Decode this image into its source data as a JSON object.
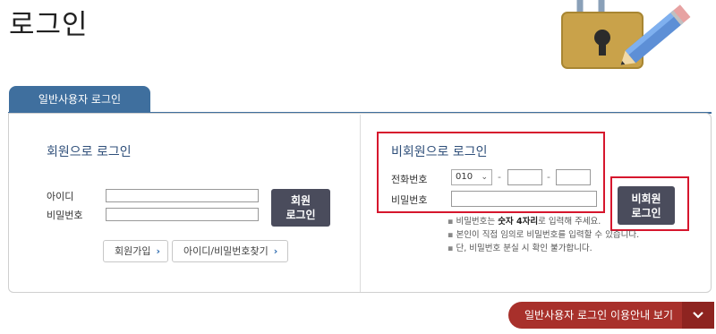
{
  "page": {
    "title": "로그인"
  },
  "tabs": [
    {
      "label": "일반사용자 로그인",
      "active": true
    }
  ],
  "member_login": {
    "title": "회원으로 로그인",
    "id_label": "아이디",
    "password_label": "비밀번호",
    "id_value": "",
    "password_value": "",
    "login_button": "회원\n로그인",
    "login_button_line1": "회원",
    "login_button_line2": "로그인",
    "signup_button": "회원가입",
    "find_button": "아이디/비밀번호찾기"
  },
  "guest_login": {
    "title": "비회원으로 로그인",
    "phone_label": "전화번호",
    "password_label": "비밀번호",
    "phone_prefix": "010",
    "phone_separator": "-",
    "phone_middle": "",
    "phone_last": "",
    "password_value": "",
    "login_button_line1": "비회원",
    "login_button_line2": "로그인",
    "notes": {
      "note1_pre": "비밀번호는 ",
      "note1_bold": "숫자 4자리",
      "note1_post": "로 입력해 주세요.",
      "note2": "본인이 직접 임의로 비밀번호를 입력할 수 있습니다.",
      "note3": "단, 비밀번호 분실 시 확인 불가합니다.",
      "bullet": "▪"
    }
  },
  "guide": {
    "label": "일반사용자 로그인 이용안내 보기",
    "toggle_icon": "chevron-down-icon"
  },
  "icons": {
    "link_arrow": "›",
    "chevron_down": "⌄"
  },
  "colors": {
    "tab": "#3f6f9e",
    "dark_button": "#4a4c5c",
    "highlight": "#d6162d",
    "guide_bar": "#a8302b"
  }
}
